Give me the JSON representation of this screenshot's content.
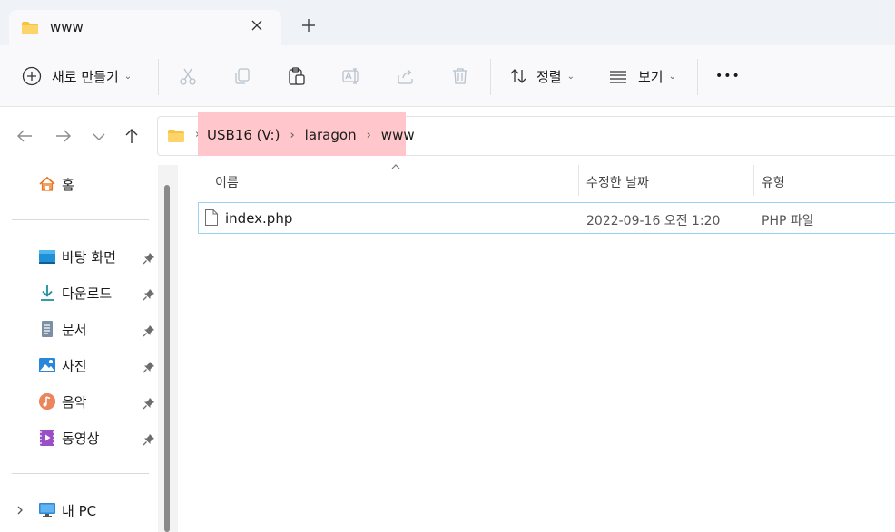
{
  "window": {
    "tab_title": "www",
    "tab_close_icon": "close-icon",
    "new_tab_icon": "plus-icon"
  },
  "toolbar": {
    "new_label": "새로 만들기",
    "sort_label": "정렬",
    "view_label": "보기",
    "more_label": "•••",
    "icons": [
      "cut-icon",
      "copy-icon",
      "paste-icon",
      "rename-icon",
      "share-icon",
      "delete-icon"
    ]
  },
  "address": {
    "crumbs": [
      "USB16 (V:)",
      "laragon",
      "www"
    ],
    "highlight_color": "#ffc7cb"
  },
  "sidebar": {
    "home_label": "홈",
    "quick_access": [
      {
        "label": "바탕 화면",
        "icon": "desktop-icon"
      },
      {
        "label": "다운로드",
        "icon": "download-icon"
      },
      {
        "label": "문서",
        "icon": "document-icon"
      },
      {
        "label": "사진",
        "icon": "pictures-icon"
      },
      {
        "label": "음악",
        "icon": "music-icon"
      },
      {
        "label": "동영상",
        "icon": "videos-icon"
      }
    ],
    "this_pc_label": "내 PC"
  },
  "columns": {
    "name": "이름",
    "date": "수정한 날짜",
    "type": "유형"
  },
  "files": [
    {
      "name": "index.php",
      "date": "2022-09-16 오전 1:20",
      "type": "PHP 파일"
    }
  ],
  "colors": {
    "accent": "#0067c0",
    "selection_border": "#9ad3f3",
    "folder": "#f8c440"
  }
}
